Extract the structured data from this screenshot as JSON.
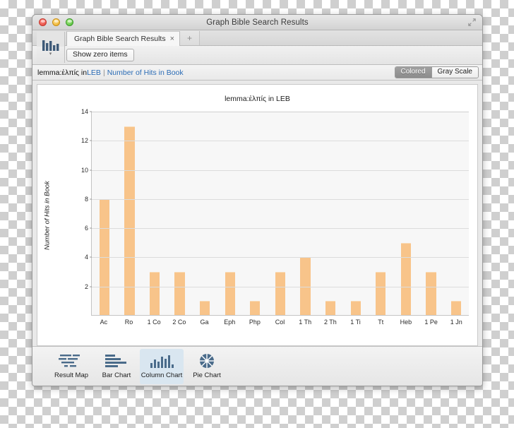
{
  "window": {
    "title": "Graph Bible Search Results",
    "controls": {
      "close": "close",
      "minimize": "minimize",
      "zoom": "zoom"
    },
    "expand_icon": "expand-icon"
  },
  "tabs": {
    "items": [
      {
        "label": "Graph Bible Search Results",
        "close": "×",
        "active": true
      }
    ],
    "add_label": "+"
  },
  "app_icon": {
    "name": "bar-chart-app-icon",
    "caret": "▾"
  },
  "toolbar": {
    "show_zero_items_label": "Show zero items"
  },
  "breadcrumb": {
    "prefix": "lemma:ἐλπίς in ",
    "corpus": "LEB",
    "separator": "|",
    "metric": "Number of Hits in Book"
  },
  "color_mode": {
    "options": [
      {
        "label": "Colored",
        "selected": true
      },
      {
        "label": "Gray Scale",
        "selected": false
      }
    ]
  },
  "chart_type_bar": {
    "items": [
      {
        "label": "Result Map",
        "icon": "result-map-icon",
        "selected": false
      },
      {
        "label": "Bar Chart",
        "icon": "bar-chart-icon",
        "selected": false
      },
      {
        "label": "Column Chart",
        "icon": "column-chart-icon",
        "selected": true
      },
      {
        "label": "Pie Chart",
        "icon": "pie-chart-icon",
        "selected": false
      }
    ]
  },
  "chart_data": {
    "type": "bar",
    "title": "lemma:ἐλπίς in LEB",
    "xlabel": "",
    "ylabel": "Number of Hits in Book",
    "categories": [
      "Ac",
      "Ro",
      "1 Co",
      "2 Co",
      "Ga",
      "Eph",
      "Php",
      "Col",
      "1 Th",
      "2 Th",
      "1 Ti",
      "Tt",
      "Heb",
      "1 Pe",
      "1 Jn"
    ],
    "values": [
      8,
      13,
      3,
      3,
      1,
      3,
      1,
      3,
      4,
      1,
      1,
      3,
      5,
      3,
      1
    ],
    "ylim": [
      0,
      14
    ],
    "yticks": [
      2,
      4,
      6,
      8,
      10,
      12,
      14
    ],
    "grid": true,
    "legend": "none",
    "bar_color": "#f8c48a",
    "plot_background": "#f7f7f7"
  }
}
